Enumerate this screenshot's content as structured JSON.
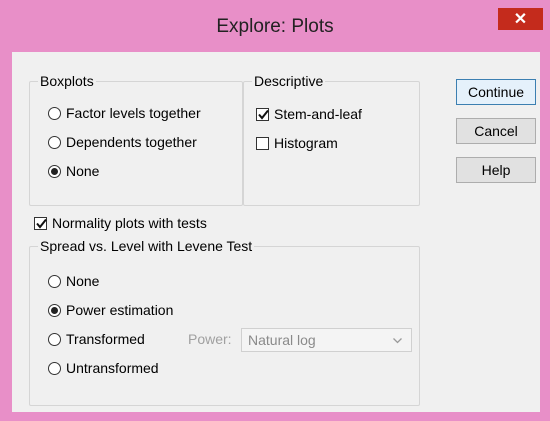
{
  "window": {
    "title": "Explore: Plots",
    "close_glyph": "✕"
  },
  "boxplots": {
    "title": "Boxplots",
    "options": [
      {
        "label": "Factor levels together",
        "selected": false
      },
      {
        "label": "Dependents together",
        "selected": false
      },
      {
        "label": "None",
        "selected": true
      }
    ]
  },
  "descriptive": {
    "title": "Descriptive",
    "options": [
      {
        "label": "Stem-and-leaf",
        "checked": true
      },
      {
        "label": "Histogram",
        "checked": false
      }
    ]
  },
  "buttons": {
    "continue": "Continue",
    "cancel": "Cancel",
    "help": "Help"
  },
  "normality": {
    "label": "Normality plots with tests",
    "checked": true
  },
  "spread": {
    "title": "Spread vs. Level with Levene Test",
    "options": [
      {
        "label": "None",
        "selected": false
      },
      {
        "label": "Power estimation",
        "selected": true
      },
      {
        "label": "Transformed",
        "selected": false
      },
      {
        "label": "Untransformed",
        "selected": false
      }
    ],
    "power_label": "Power:",
    "power_value": "Natural log"
  },
  "colors": {
    "titlebar": "#e88fc8",
    "close": "#c42b1c",
    "client": "#f0f0f0"
  },
  "icons": {
    "close": "close-icon",
    "check": "checkmark-icon",
    "dropdown": "chevron-down-icon"
  }
}
